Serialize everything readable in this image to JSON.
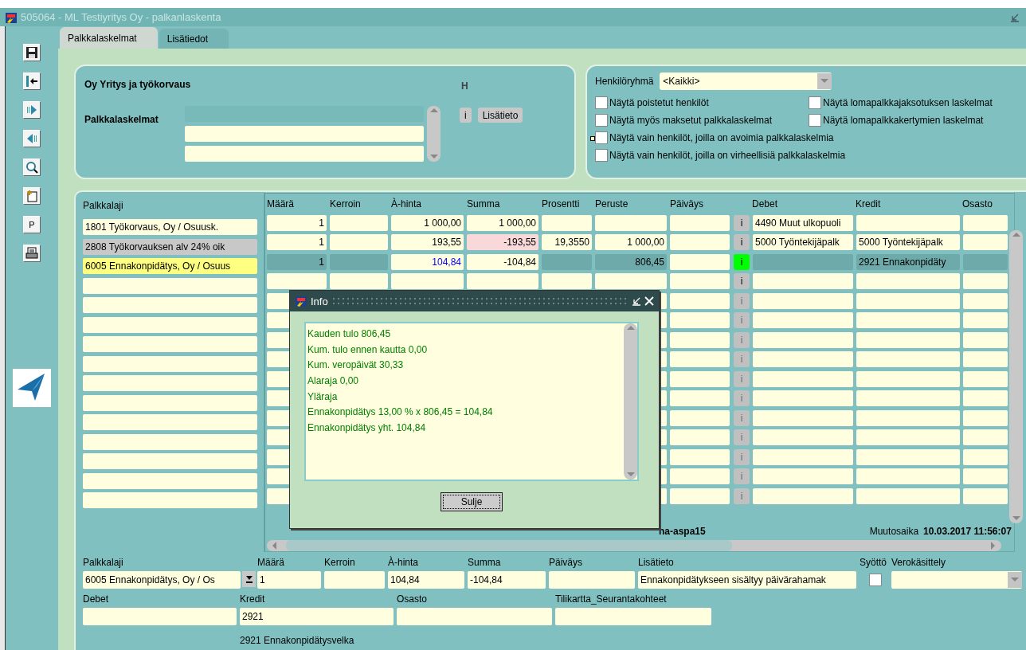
{
  "window": {
    "title": "505064 - ML Testiyritys Oy - palkanlaskenta"
  },
  "toolbar": {
    "letter_button": "P"
  },
  "tabs": [
    {
      "label": "Palkkalaskelmat",
      "selected": true
    },
    {
      "label": "Lisätiedot",
      "selected": false
    }
  ],
  "header_panel": {
    "heading": "Oy Yritys ja työkorvaus",
    "flag": "H",
    "list_label": "Palkkalaskelmat",
    "info_button": "i",
    "details_button": "Lisätieto"
  },
  "filter_panel": {
    "group_label": "Henkilöryhmä",
    "group_value": "<Kaikki>",
    "checkboxes": [
      {
        "label": "Näytä poistetut henkilöt",
        "checked": false,
        "focused": false
      },
      {
        "label": "Näytä lomapalkkajaksotuksen laskelmat",
        "checked": false,
        "focused": false
      },
      {
        "label": "Näytä myös maksetut palkkalaskelmat",
        "checked": false,
        "focused": false
      },
      {
        "label": "Näytä lomapalkkakertymien laskelmat",
        "checked": false,
        "focused": false
      },
      {
        "label": "Näytä vain henkilöt, joilla on avoimia palkkalaskelmia",
        "checked": false,
        "focused": true
      },
      {
        "label": "Näytä vain henkilöt, joilla on virheellisiä palkkalaskelmia",
        "checked": false,
        "focused": false
      }
    ]
  },
  "grid": {
    "columns": [
      "Palkkalaji",
      "Määrä",
      "Kerroin",
      "À-hinta",
      "Summa",
      "Prosentti",
      "Peruste",
      "Päiväys",
      "Debet",
      "Kredit",
      "Osasto"
    ],
    "rows": [
      {
        "palkkalaji": "1801 Työkorvaus, Oy / Osuusk.",
        "maara": "1",
        "a_hinta": "1 000,00",
        "summa": "1 000,00",
        "debet": "4490 Muut ulkopuoli",
        "info": "i",
        "selected": false,
        "disabled": false,
        "greyed": false,
        "warning": false,
        "active": false
      },
      {
        "palkkalaji": "2808 Työkorvauksen alv 24% oik",
        "maara": "1",
        "a_hinta": "193,55",
        "summa": "-193,55",
        "prosentti": "19,3550",
        "peruste": "1 000,00",
        "debet": "5000 Työntekijäpalk",
        "kredit": "5000 Työntekijäpalk",
        "info": "i",
        "selected": false,
        "disabled": false,
        "greyed": true,
        "warning": true,
        "active": false
      },
      {
        "palkkalaji": "6005 Ennakonpidätys, Oy / Osuus",
        "maara": "1",
        "a_hinta": "104,84",
        "summa": "-104,84",
        "peruste": "806,45",
        "kredit": "2921 Ennakonpidäty",
        "info": "i",
        "selected": true,
        "disabled": false,
        "greyed": false,
        "warning": false,
        "active": true
      },
      {
        "info": "i",
        "selected": false,
        "disabled": false,
        "greyed": false,
        "warning": false,
        "active": false
      },
      {
        "info": "i",
        "selected": false,
        "disabled": true,
        "greyed": false,
        "warning": false,
        "active": false
      },
      {
        "info": "i",
        "selected": false,
        "disabled": true,
        "greyed": false,
        "warning": false,
        "active": false
      },
      {
        "info": "i",
        "selected": false,
        "disabled": true,
        "greyed": false,
        "warning": false,
        "active": false
      },
      {
        "info": "i",
        "selected": false,
        "disabled": true,
        "greyed": false,
        "warning": false,
        "active": false
      },
      {
        "info": "i",
        "selected": false,
        "disabled": true,
        "greyed": false,
        "warning": false,
        "active": false
      },
      {
        "info": "i",
        "selected": false,
        "disabled": true,
        "greyed": false,
        "warning": false,
        "active": false
      },
      {
        "info": "i",
        "selected": false,
        "disabled": true,
        "greyed": false,
        "warning": false,
        "active": false
      },
      {
        "info": "i",
        "selected": false,
        "disabled": true,
        "greyed": false,
        "warning": false,
        "active": false
      },
      {
        "info": "i",
        "selected": false,
        "disabled": true,
        "greyed": false,
        "warning": false,
        "active": false
      },
      {
        "info": "i",
        "selected": false,
        "disabled": true,
        "greyed": false,
        "warning": false,
        "active": false
      },
      {
        "info": "i",
        "selected": false,
        "disabled": true,
        "greyed": false,
        "warning": false,
        "active": false
      }
    ],
    "user": "na-aspa15",
    "modified_label": "Muutosaika",
    "modified_value": "10.03.2017 11:56:07"
  },
  "detail_form": {
    "row_1": [
      {
        "kind": "lookup",
        "label": "Palkkalaji",
        "value": "6005 Ennakonpidätys, Oy / Os"
      },
      {
        "kind": "text",
        "label": "Määrä",
        "value": "1"
      },
      {
        "kind": "text",
        "label": "Kerroin"
      },
      {
        "kind": "text",
        "label": "À-hinta",
        "value": "104,84"
      },
      {
        "kind": "text",
        "label": "Summa",
        "value": "-104,84"
      },
      {
        "kind": "text",
        "label": "Päiväys"
      },
      {
        "kind": "text",
        "label": "Lisätieto",
        "value": "Ennakonpidätykseen sisältyy päivärahamak"
      },
      {
        "kind": "checkbox",
        "label": "Syöttö",
        "checked": false
      },
      {
        "kind": "select",
        "label": "Verokäsittely"
      }
    ],
    "row_2": [
      {
        "kind": "text",
        "label": "Debet"
      },
      {
        "kind": "text",
        "label": "Kredit",
        "value": "2921"
      },
      {
        "kind": "text",
        "label": "Osasto"
      },
      {
        "kind": "text",
        "label": "Tilikartta_Seurantakohteet"
      }
    ],
    "kredit_description": "2921 Ennakonpidätysvelka"
  },
  "info_dialog": {
    "title": "Info",
    "lines": [
      "Kauden tulo 806,45",
      "Kum. tulo ennen kautta 0,00",
      "Kum. veropäivät 30,33",
      "Alaraja 0,00",
      "Yläraja",
      "Ennakonpidätys 13,00 % x 806,45 = 104,84",
      "Ennakonpidätys yht. 104,84"
    ],
    "close_button": "Sulje"
  }
}
